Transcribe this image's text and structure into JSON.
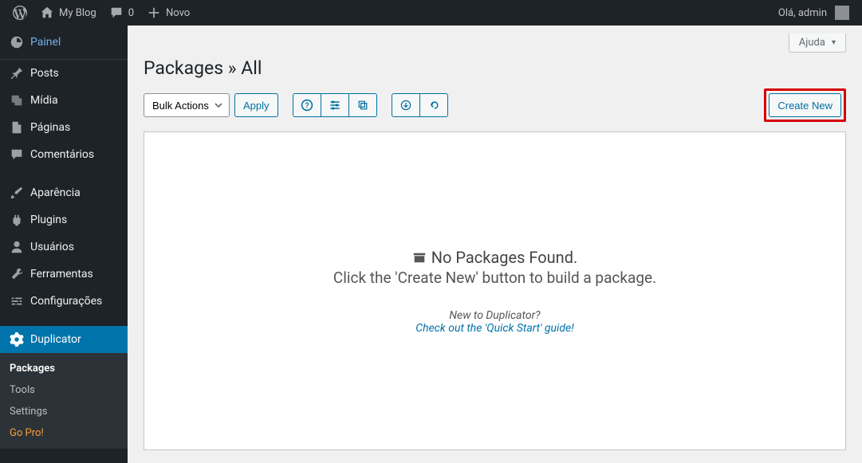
{
  "adminbar": {
    "site_name": "My Blog",
    "comments_count": "0",
    "new_label": "Novo",
    "greeting": "Olá, admin"
  },
  "sidebar": {
    "dashboard": "Painel",
    "items": [
      {
        "label": "Posts"
      },
      {
        "label": "Mídia"
      },
      {
        "label": "Páginas"
      },
      {
        "label": "Comentários"
      }
    ],
    "items2": [
      {
        "label": "Aparência"
      },
      {
        "label": "Plugins"
      },
      {
        "label": "Usuários"
      },
      {
        "label": "Ferramentas"
      },
      {
        "label": "Configurações"
      }
    ],
    "duplicator": "Duplicator",
    "submenu": {
      "packages": "Packages",
      "tools": "Tools",
      "settings": "Settings",
      "gopro": "Go Pro!"
    }
  },
  "content": {
    "help": "Ajuda",
    "title": "Packages » All",
    "bulk_actions": "Bulk Actions",
    "apply": "Apply",
    "create_new": "Create New",
    "empty": {
      "title": "No Packages Found.",
      "sub": "Click the 'Create New' button to build a package.",
      "hint": "New to Duplicator?",
      "link": "Check out the 'Quick Start' guide!"
    }
  }
}
